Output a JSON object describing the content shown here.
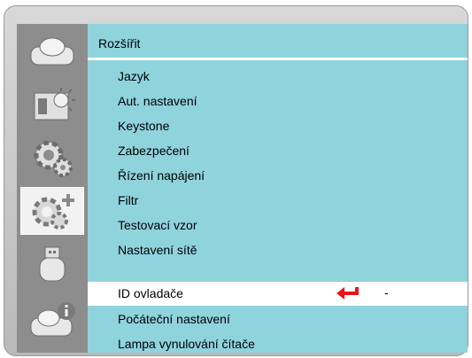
{
  "menu": {
    "title": "Rozšířit",
    "items": [
      {
        "label": "Jazyk"
      },
      {
        "label": "Aut. nastavení"
      },
      {
        "label": "Keystone"
      },
      {
        "label": "Zabezpečení"
      },
      {
        "label": "Řízení napájení"
      },
      {
        "label": "Filtr"
      },
      {
        "label": "Testovací vzor"
      },
      {
        "label": "Nastavení sítě"
      },
      {
        "label": "ID ovladače",
        "value": "-"
      },
      {
        "label": "Počáteční nastavení"
      },
      {
        "label": "Lampa vynulování čítače"
      }
    ]
  },
  "sidebar": {
    "tabs": [
      {
        "icon": "projector-icon"
      },
      {
        "icon": "display-brightness-icon"
      },
      {
        "icon": "gear-icon"
      },
      {
        "icon": "gear-plus-icon"
      },
      {
        "icon": "usb-drive-icon"
      },
      {
        "icon": "projector-info-icon"
      }
    ]
  },
  "colors": {
    "panel": "#8fd3dd",
    "selected": "#ffffff",
    "sidebar": "#8d8d8d",
    "arrow": "#e8141c"
  }
}
